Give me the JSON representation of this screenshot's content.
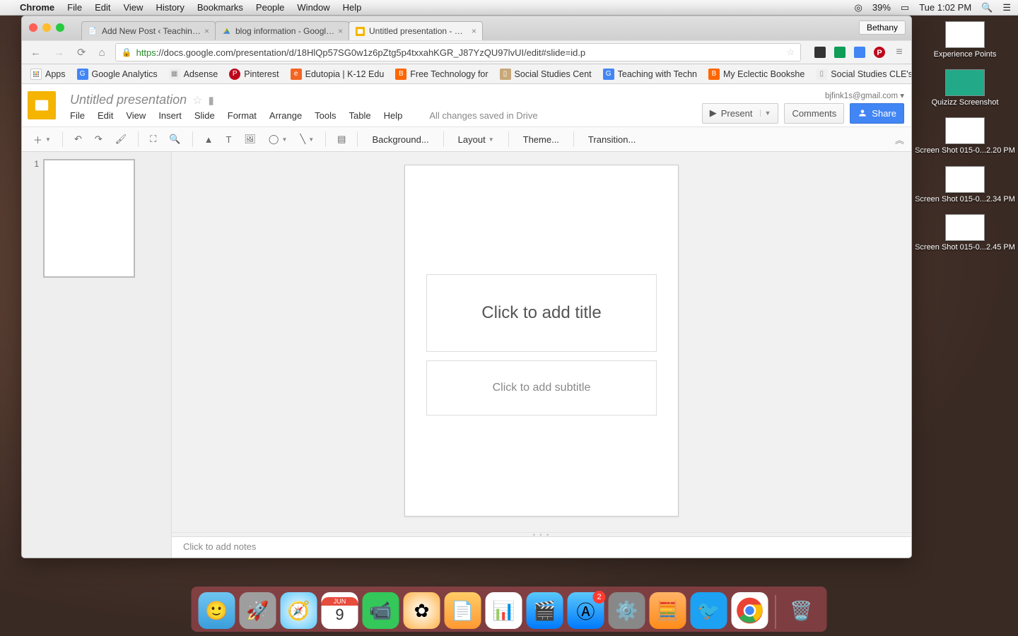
{
  "menubar": {
    "app": "Chrome",
    "items": [
      "File",
      "Edit",
      "View",
      "History",
      "Bookmarks",
      "People",
      "Window",
      "Help"
    ],
    "battery": "39%",
    "clock": "Tue 1:02 PM"
  },
  "desktop_icons": [
    {
      "label": "Experience Points"
    },
    {
      "label": "Quizizz Screenshot"
    },
    {
      "label": "Screen Shot 015-0...2.20 PM"
    },
    {
      "label": "Screen Shot 015-0...2.34 PM"
    },
    {
      "label": "Screen Shot 015-0...2.45 PM"
    }
  ],
  "browser": {
    "profile": "Bethany",
    "tabs": [
      {
        "title": "Add New Post ‹ Teaching w",
        "icon": "wp",
        "active": false
      },
      {
        "title": "blog information - Google D",
        "icon": "drive",
        "active": false
      },
      {
        "title": "Untitled presentation - Goo",
        "icon": "slides",
        "active": true
      }
    ],
    "url_prefix": "https",
    "url_rest": "://docs.google.com/presentation/d/18HlQp57SG0w1z6pZtg5p4txxahKGR_J87YzQU97lvUI/edit#slide=id.p",
    "bookmarks": [
      {
        "label": "Apps",
        "color": "#fff"
      },
      {
        "label": "Google Analytics",
        "color": "#4285f4"
      },
      {
        "label": "Adsense",
        "color": "#e0e0e0"
      },
      {
        "label": "Pinterest",
        "color": "#bd081c"
      },
      {
        "label": "Edutopia | K-12 Edu",
        "color": "#f26522"
      },
      {
        "label": "Free Technology for",
        "color": "#ff6600"
      },
      {
        "label": "Social Studies Cent",
        "color": "#c8a878"
      },
      {
        "label": "Teaching with Techn",
        "color": "#4285f4"
      },
      {
        "label": "My Eclectic Bookshe",
        "color": "#ff6600"
      },
      {
        "label": "Social Studies CLE's",
        "color": "#ddd"
      }
    ]
  },
  "slides": {
    "title": "Untitled presentation",
    "account": "bjfink1s@gmail.com",
    "menus": [
      "File",
      "Edit",
      "View",
      "Insert",
      "Slide",
      "Format",
      "Arrange",
      "Tools",
      "Table",
      "Help"
    ],
    "saved": "All changes saved in Drive",
    "buttons": {
      "present": "Present",
      "comments": "Comments",
      "share": "Share"
    },
    "toolbar": {
      "background": "Background...",
      "layout": "Layout",
      "theme": "Theme...",
      "transition": "Transition..."
    },
    "thumb_number": "1",
    "placeholders": {
      "title": "Click to add title",
      "subtitle": "Click to add subtitle"
    },
    "notes": "Click to add notes"
  },
  "dock": {
    "appstore_badge": "2",
    "calendar_month": "JUN",
    "calendar_day": "9"
  }
}
